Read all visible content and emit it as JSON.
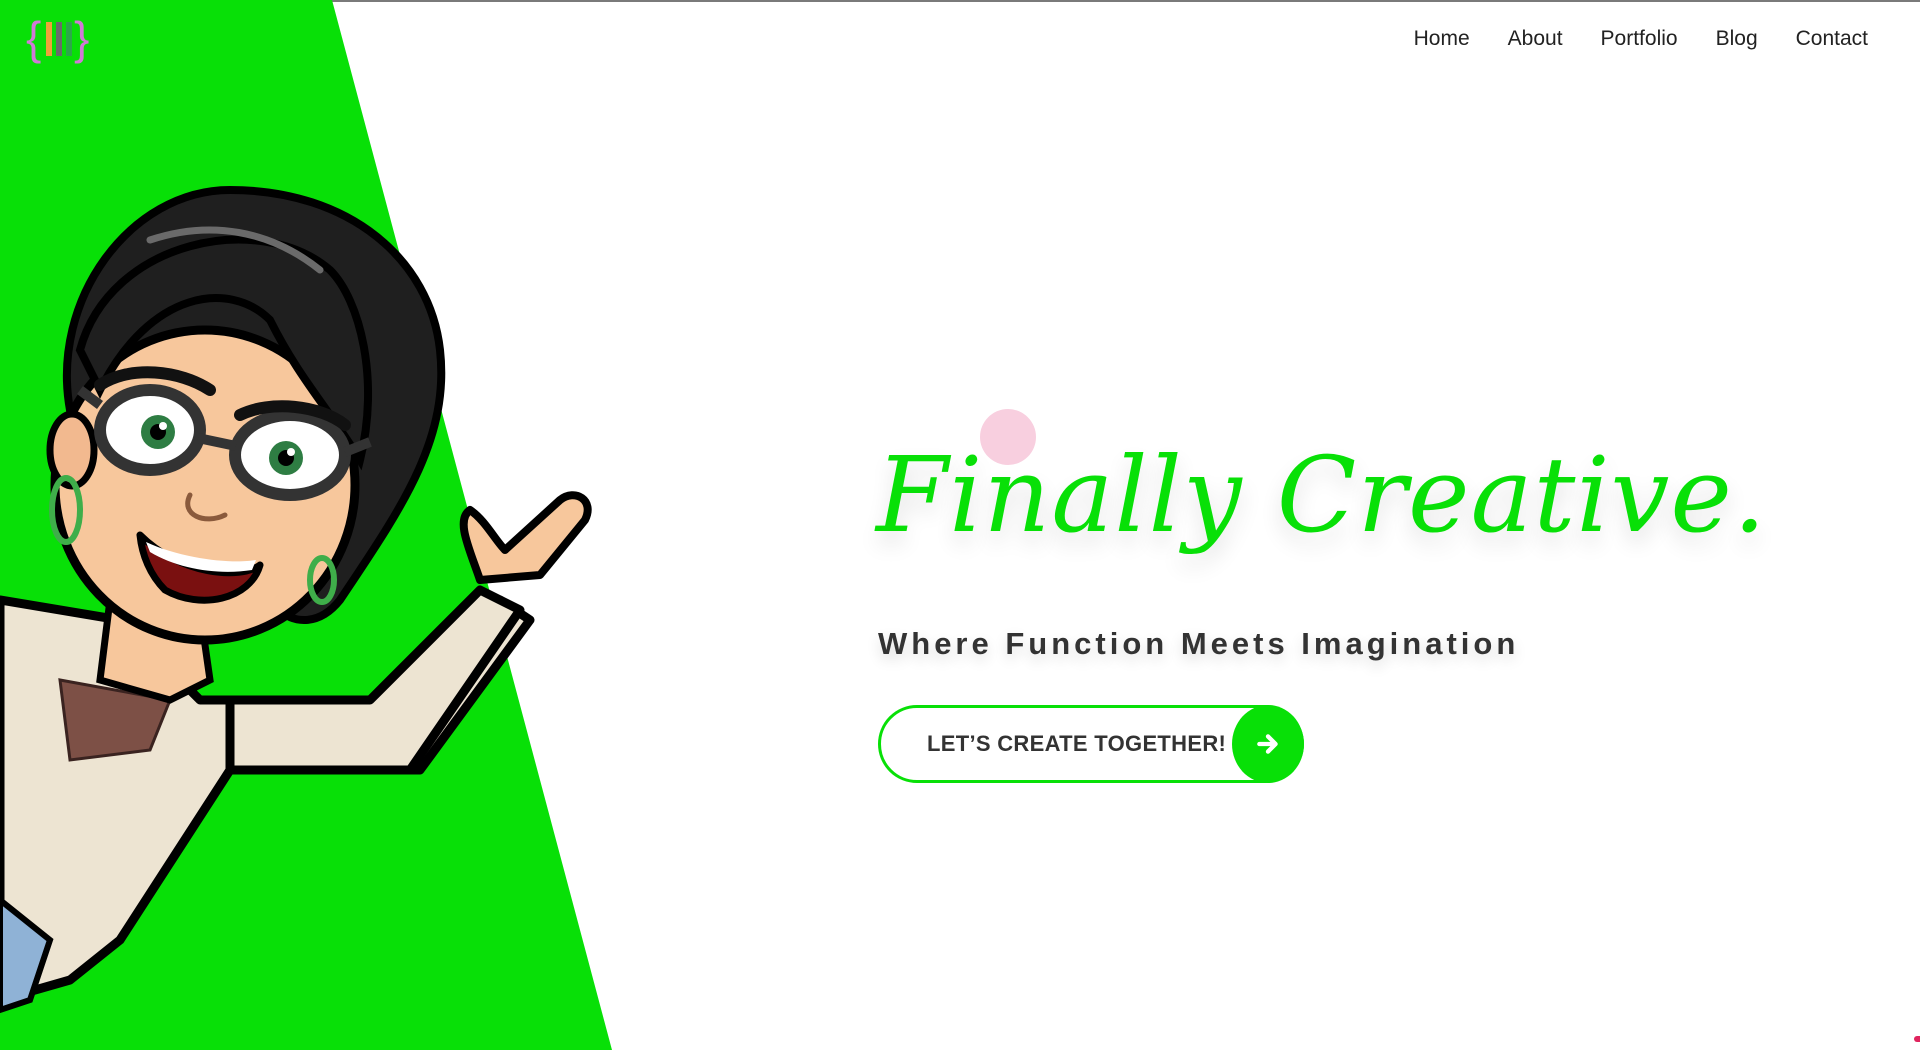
{
  "site": {
    "logo": {
      "icon": "curly-braces-bars-logo",
      "colors": [
        "#d07ad6",
        "#f0a23a",
        "#2ca84a"
      ]
    }
  },
  "nav": {
    "items": [
      {
        "label": "Home"
      },
      {
        "label": "About"
      },
      {
        "label": "Portfolio"
      },
      {
        "label": "Blog"
      },
      {
        "label": "Contact"
      }
    ]
  },
  "hero": {
    "title": "Finally Creative.",
    "subtitle": "Where Function Meets Imagination",
    "cta": {
      "label": "LET’S CREATE TOGETHER!",
      "icon": "arrow-right-icon"
    },
    "illustration": "cartoon-woman-avatar"
  },
  "colors": {
    "accent": "#08e007",
    "text": "#333333",
    "pink_dot": "#f8cfdf",
    "background": "#ffffff"
  }
}
